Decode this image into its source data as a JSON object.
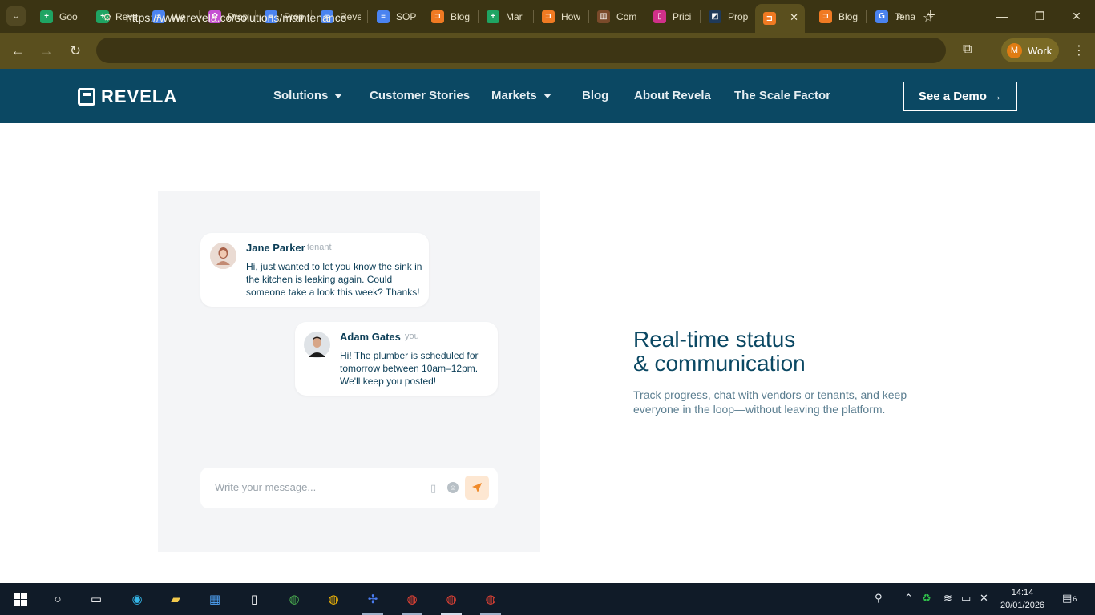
{
  "browser": {
    "tabs": [
      {
        "title": "Goo",
        "color": "#1fa463",
        "glyph": "+"
      },
      {
        "title": "Reve",
        "color": "#1fa463",
        "glyph": "+"
      },
      {
        "title": "We",
        "color": "#4a83f0",
        "glyph": "≡"
      },
      {
        "title": "Prop",
        "color": "#c54fd2",
        "glyph": "✿"
      },
      {
        "title": "Prop",
        "color": "#4a83f0",
        "glyph": "≡"
      },
      {
        "title": "Reve",
        "color": "#4a83f0",
        "glyph": "≡"
      },
      {
        "title": "SOP",
        "color": "#4a83f0",
        "glyph": "≡"
      },
      {
        "title": "Blog",
        "color": "#f07a22",
        "glyph": "⊐"
      },
      {
        "title": "Mar",
        "color": "#1fa463",
        "glyph": "+"
      },
      {
        "title": "How",
        "color": "#f07a22",
        "glyph": "⊐"
      },
      {
        "title": "Com",
        "color": "#7a4a2a",
        "glyph": "▥"
      },
      {
        "title": "Prici",
        "color": "#d0308a",
        "glyph": "▯"
      },
      {
        "title": "Prop",
        "color": "#1f3a5a",
        "glyph": "◩"
      },
      {
        "title": "",
        "color": "#f07a22",
        "glyph": "⊐"
      },
      {
        "title": "Blog",
        "color": "#f07a22",
        "glyph": "⊐"
      },
      {
        "title": "Tena",
        "color": "#4a83f0",
        "glyph": "G"
      }
    ],
    "url": "https://www.revela.co/solutions/maintenance",
    "profile_initial": "M",
    "profile_label": "Work"
  },
  "site": {
    "logo_text": "REVELA",
    "nav": [
      {
        "label": "Solutions",
        "dropdown": true
      },
      {
        "label": "Customer Stories",
        "dropdown": false
      },
      {
        "label": "Markets",
        "dropdown": true
      },
      {
        "label": "Blog",
        "dropdown": false
      },
      {
        "label": "About Revela",
        "dropdown": false
      },
      {
        "label": "The Scale Factor",
        "dropdown": false
      }
    ],
    "demo_button": "See a Demo →"
  },
  "chat": {
    "messages": [
      {
        "name": "Jane Parker",
        "role": "tenant",
        "text": "Hi, just wanted to let you know the sink in the kitchen is leaking again. Could someone take a look this week? Thanks!"
      },
      {
        "name": "Adam Gates",
        "role": "you",
        "text": "Hi! The plumber is scheduled for tomorrow between 10am–12pm. We'll keep you posted!"
      }
    ],
    "composer_placeholder": "Write your message..."
  },
  "feature": {
    "title": "Real-time status\n& communication",
    "description": "Track progress, chat with vendors or tenants, and keep everyone in the loop—without leaving the platform."
  },
  "taskbar": {
    "time": "14:14",
    "date": "20/01/2026",
    "notifications": "6"
  }
}
